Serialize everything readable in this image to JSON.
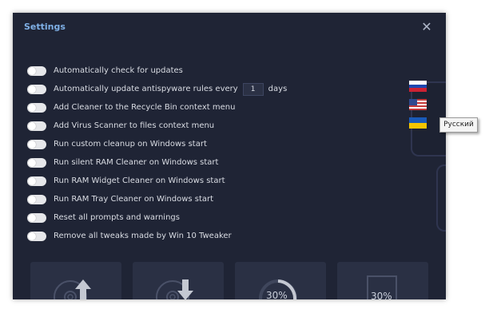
{
  "dialog": {
    "title": "Settings",
    "close_glyph": "✕"
  },
  "settings": [
    {
      "label": "Automatically check for updates",
      "enabled": false
    },
    {
      "label": "Automatically update antispyware rules every",
      "enabled": false,
      "value": "1",
      "suffix": "days"
    },
    {
      "label": "Add Cleaner to the Recycle Bin context menu",
      "enabled": false
    },
    {
      "label": "Add Virus Scanner to files context menu",
      "enabled": false
    },
    {
      "label": "Run custom cleanup on Windows start",
      "enabled": false
    },
    {
      "label": "Run silent RAM Cleaner on Windows start",
      "enabled": false
    },
    {
      "label": "Run RAM Widget Cleaner on Windows start",
      "enabled": false
    },
    {
      "label": "Run RAM Tray Cleaner on Windows start",
      "enabled": false
    },
    {
      "label": "Reset all prompts and warnings",
      "enabled": false
    },
    {
      "label": "Remove all tweaks made by Win 10 Tweaker",
      "enabled": false
    }
  ],
  "languages": {
    "flags": [
      "russian-flag",
      "us-flag",
      "ukrainian-flag"
    ],
    "tooltip": "Русский"
  },
  "cards": [
    {
      "icon": "disc-upload-icon"
    },
    {
      "icon": "disc-download-icon"
    },
    {
      "icon": "ram-circle-icon",
      "percent": "30%"
    },
    {
      "icon": "ram-square-icon",
      "percent": "30%"
    }
  ],
  "colors": {
    "background": "#1f2435",
    "title": "#7fb0e6",
    "text": "#d9dce3",
    "toggle_off": "#e6e7ea",
    "card": "#2a3044"
  }
}
